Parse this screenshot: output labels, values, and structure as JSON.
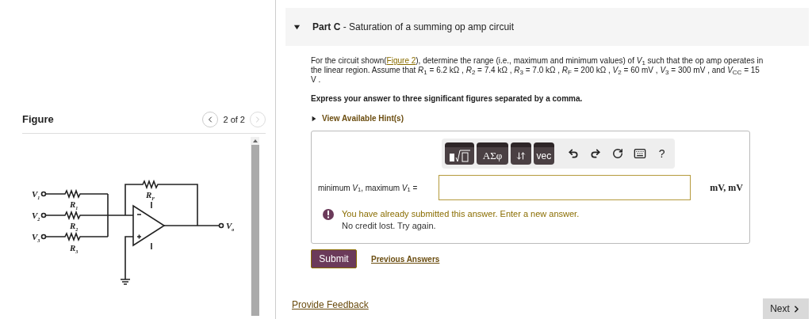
{
  "figure": {
    "title": "Figure",
    "pager": "2 of 2",
    "prev_disabled": false,
    "next_disabled": true,
    "labels": [
      {
        "text": "V",
        "sub": "1"
      },
      {
        "text": "V",
        "sub": "2"
      },
      {
        "text": "V",
        "sub": "3"
      },
      {
        "text": "R",
        "sub": "1"
      },
      {
        "text": "R",
        "sub": "2"
      },
      {
        "text": "R",
        "sub": "3"
      },
      {
        "text": "R",
        "sub": "F"
      },
      {
        "text": "V",
        "sub": "o"
      }
    ]
  },
  "part": {
    "title": "**Part C** - Saturation of a summing op amp circuit",
    "expanded": true
  },
  "problem": {
    "before": "For the circuit shown(",
    "link": "Figure 2",
    "after": "), determine the range (i.e., maximum and minimum values) of *V*$_{1}$ such that the op amp operates in the linear region. Assume that *R*$_{1}$ = 6.2 kΩ , *R*$_{2}$ = 7.4 kΩ , *R*$_{3}$ = 7.0 kΩ , *R*$_{F}$ = 200 kΩ , *V*$_{2}$ = 60 mV , *V*$_{3}$ = 300 mV , and *V*$_{CC}$ = 15 V ."
  },
  "instruction": "Express your answer to three significant figures separated by a comma.",
  "hint": {
    "label": "View Available Hint(s)",
    "expanded": false
  },
  "toolbar": [
    {
      "kind": "templates"
    },
    {
      "kind": "greek",
      "label": "ΑΣφ"
    },
    {
      "kind": "arrows"
    },
    {
      "kind": "vector",
      "label": "vec"
    },
    {
      "kind": "undo"
    },
    {
      "kind": "redo"
    },
    {
      "kind": "reset"
    },
    {
      "kind": "keyboard"
    },
    {
      "kind": "help",
      "label": "?"
    }
  ],
  "answer": {
    "label": "minimum *V*$_{1}$, maximum *V*$_{1}$ =",
    "units": "mV, mV"
  },
  "feedback": {
    "message": "You have already submitted this answer. Enter a new answer.",
    "note": "No credit lost. Try again."
  },
  "submit": "Submit",
  "previous_answers": "Previous Answers",
  "provide_feedback": "Provide Feedback",
  "next": "Next"
}
